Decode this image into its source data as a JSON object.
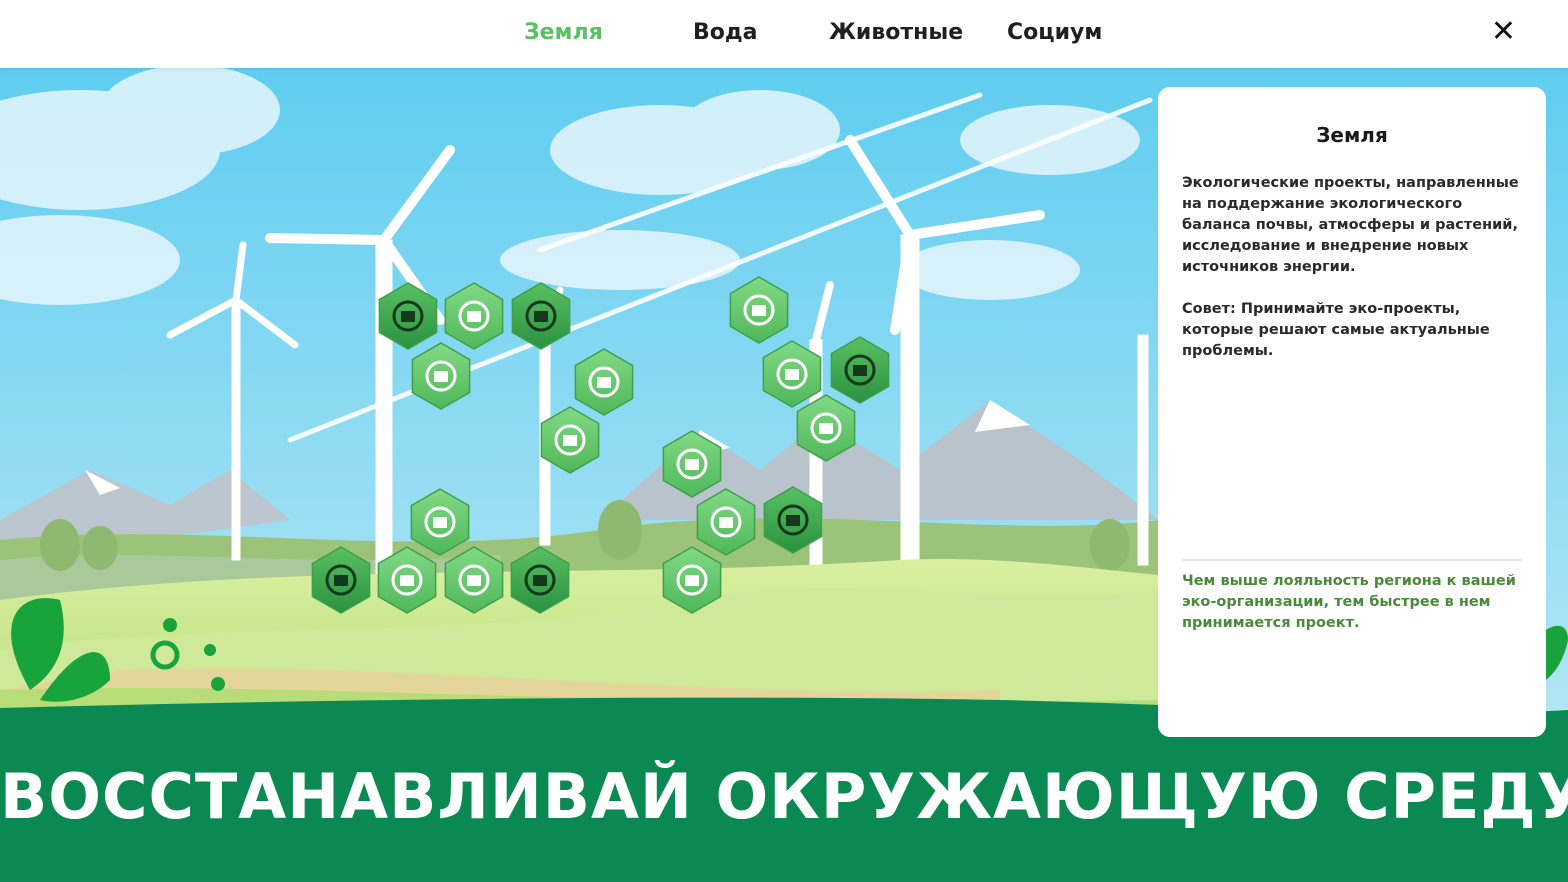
{
  "tabs": [
    {
      "label": "Земля",
      "active": true
    },
    {
      "label": "Вода",
      "active": false
    },
    {
      "label": "Животные",
      "active": false
    },
    {
      "label": "Социум",
      "active": false
    }
  ],
  "close_label": "✕",
  "panel": {
    "title": "Земля",
    "description": "Экологические проекты, направленные на поддержание экологического баланса почвы, атмосферы и растений, исследование и внедрение новых источников энергии.",
    "tip": "Совет: Принимайте эко-проекты, которые решают самые актуальные проблемы.",
    "hint": "Чем выше лояльность региона к вашей эко-организации, тем быстрее в нем принимается проект."
  },
  "banner": {
    "text": "ВОССТАНАВЛИВАЙ ОКРУЖАЮЩУЮ СРЕДУ"
  },
  "projects": [
    {
      "icon": "forest-globe-icon",
      "state": "dark"
    },
    {
      "icon": "forest-fire-hands-icon",
      "state": "light"
    },
    {
      "icon": "drone-fire-icon",
      "state": "dark"
    },
    {
      "icon": "tree-hands-icon",
      "state": "light"
    },
    {
      "icon": "tram-icon",
      "state": "light"
    },
    {
      "icon": "trolleybus-icon",
      "state": "light"
    },
    {
      "icon": "solar-panel-icon",
      "state": "light"
    },
    {
      "icon": "factory-icon",
      "state": "dark"
    },
    {
      "icon": "plug-leaf-icon",
      "state": "light"
    },
    {
      "icon": "wind-turbines-icon",
      "state": "light"
    },
    {
      "icon": "smokestack-filter-icon",
      "state": "dark"
    },
    {
      "icon": "biohazard-recycle-icon",
      "state": "light"
    },
    {
      "icon": "recycle-truck-icon",
      "state": "light"
    },
    {
      "icon": "waste-truck-icon",
      "state": "dark"
    },
    {
      "icon": "water-recycle-truck-icon",
      "state": "light"
    },
    {
      "icon": "recycle-bin-icon",
      "state": "light"
    },
    {
      "icon": "recycling-plant-icon",
      "state": "light"
    },
    {
      "icon": "electric-bin-icon",
      "state": "dark"
    },
    {
      "icon": "recycle-container-icon",
      "state": "light"
    }
  ],
  "colors": {
    "active_tab": "#5bbf63",
    "hex_light": "#6fcf74",
    "hex_dark": "#2e9e45",
    "banner_green": "#0a8a52",
    "hint_green": "#4a8a3a"
  }
}
